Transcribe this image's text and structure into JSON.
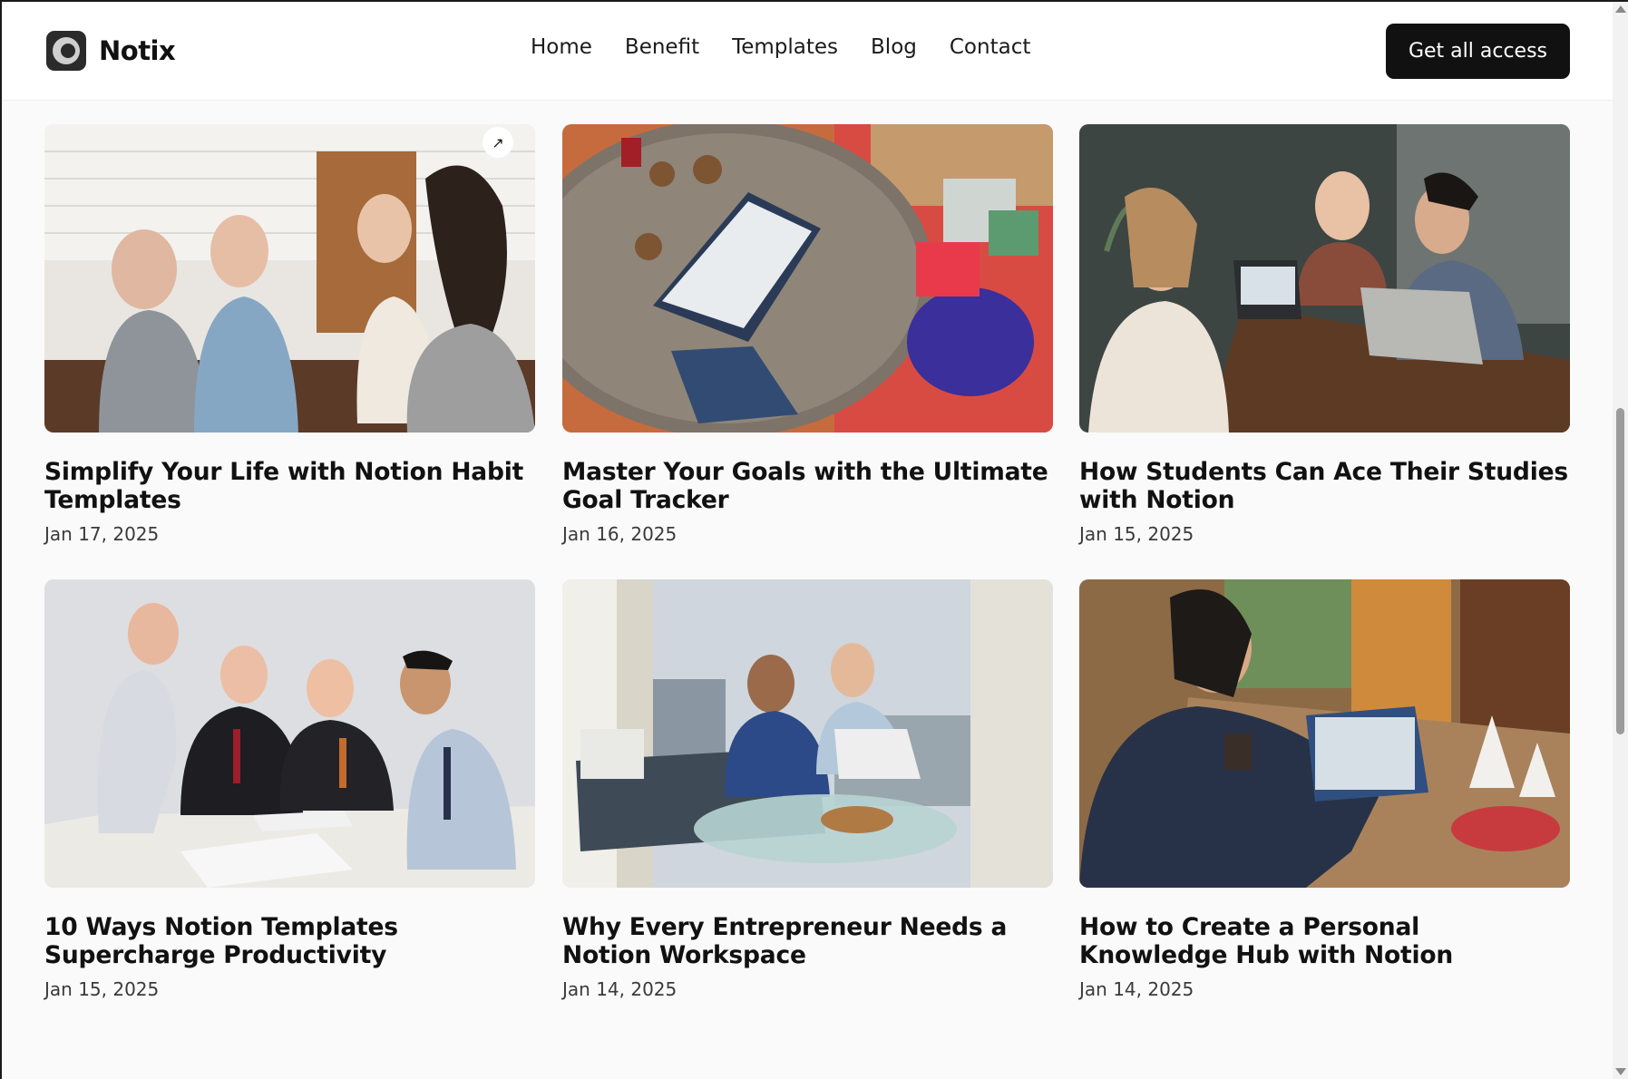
{
  "brand": {
    "name": "Notix"
  },
  "nav": [
    {
      "label": "Home"
    },
    {
      "label": "Benefit"
    },
    {
      "label": "Templates"
    },
    {
      "label": "Blog"
    },
    {
      "label": "Contact"
    }
  ],
  "cta": {
    "label": "Get all access"
  },
  "posts": [
    {
      "title": "Simplify Your Life with Notion Habit Templates",
      "date": "Jan 17, 2025"
    },
    {
      "title": "Master Your Goals with the Ultimate Goal Tracker",
      "date": "Jan 16, 2025"
    },
    {
      "title": "How Students Can Ace Their Studies with Notion",
      "date": "Jan 15, 2025"
    },
    {
      "title": "10 Ways Notion Templates Supercharge Productivity",
      "date": "Jan 15, 2025"
    },
    {
      "title": "Why Every Entrepreneur Needs a Notion Workspace",
      "date": "Jan 14, 2025"
    },
    {
      "title": "How to Create a Personal Knowledge Hub with Notion",
      "date": "Jan 14, 2025"
    }
  ],
  "icons": {
    "logo": "notix-logo-icon",
    "open": "arrow-up-right-icon"
  },
  "colors": {
    "cta_bg": "#111111",
    "page_bg": "#fafafa",
    "header_bg": "#ffffff"
  }
}
